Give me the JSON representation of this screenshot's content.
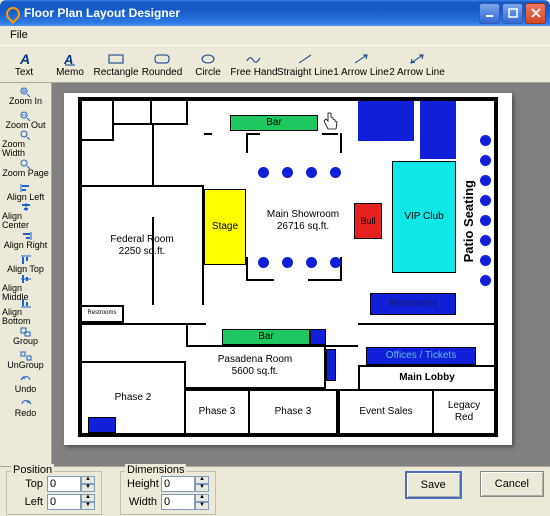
{
  "window": {
    "title": "Floor Plan Layout Designer"
  },
  "menubar": {
    "file": "File"
  },
  "top_tools": {
    "text": "Text",
    "memo": "Memo",
    "rect": "Rectangle",
    "rounded": "Rounded",
    "circle": "Circle",
    "freehand": "Free Hand",
    "sline": "Straight Line",
    "a1": "1 Arrow Line",
    "a2": "2 Arrow Line"
  },
  "left_tools": {
    "zin": "Zoom In",
    "zout": "Zoom Out",
    "zw": "Zoom Width",
    "zp": "Zoom Page",
    "al": "Align Left",
    "ac": "Align Center",
    "ar": "Align Right",
    "at": "Align Top",
    "am": "Align Middle",
    "ab": "Align Bottom",
    "grp": "Group",
    "ugrp": "UnGroup",
    "undo": "Undo",
    "redo": "Redo"
  },
  "bottom": {
    "position": "Position",
    "top": "Top",
    "left": "Left",
    "dimensions": "Dimensions",
    "height": "Height",
    "width": "Width",
    "top_v": "0",
    "left_v": "0",
    "height_v": "0",
    "width_v": "0",
    "save": "Save",
    "cancel": "Cancel"
  },
  "rooms": {
    "bar1": "Bar",
    "bar2": "Bar",
    "federal_l1": "Federal Room",
    "federal_l2": "2250 sq.ft.",
    "stage": "Stage",
    "main_l1": "Main Showroom",
    "main_l2": "26716 sq.ft.",
    "bull": "Bull",
    "vip": "VIP Club",
    "patio": "Patio Seating",
    "restrooms_s": "Restrooms",
    "restrooms": "Restrooms",
    "pasa_l1": "Pasadena Room",
    "pasa_l2": "5600 sq.ft.",
    "phase2": "Phase 2",
    "phase3a": "Phase 3",
    "phase3b": "Phase 3",
    "offices": "Offices / Tickets",
    "lobby": "Main Lobby",
    "events": "Event Sales",
    "legacy_l1": "Legacy",
    "legacy_l2": "Red"
  }
}
